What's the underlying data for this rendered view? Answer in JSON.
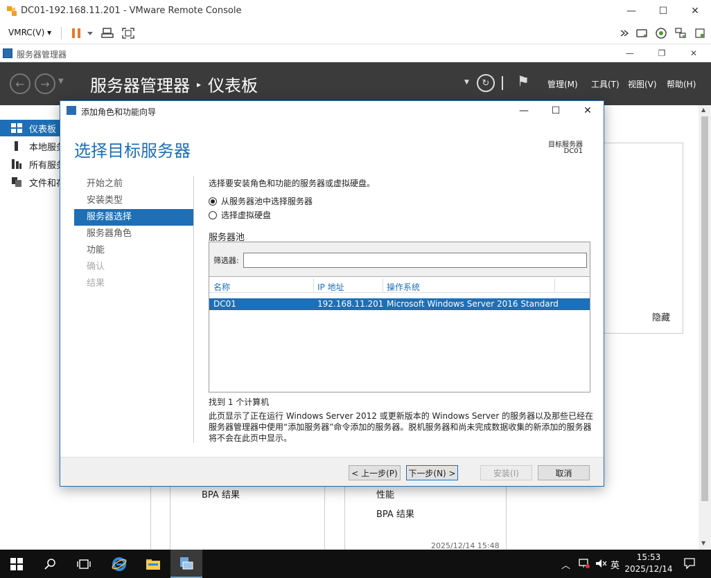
{
  "vmrc": {
    "title": "DC01-192.168.11.201 - VMware Remote Console",
    "menu_label": "VMRC(V)",
    "menu_arrow": "▾",
    "min": "—",
    "max": "☐",
    "close": "✕",
    "icons": [
      "pause-icon",
      "dropdown-icon",
      "send-keys-icon",
      "fullscreen-icon",
      "forward-icon",
      "removable-devices-icon",
      "vm-state-icon",
      "network-icon"
    ]
  },
  "server_manager": {
    "title": "服务器管理器",
    "breadcrumb_root": "服务器管理器",
    "breadcrumb_sep": "▸",
    "breadcrumb_page": "仪表板",
    "menus": [
      "管理(M)",
      "工具(T)",
      "视图(V)",
      "帮助(H)"
    ],
    "sidebar": [
      {
        "label": "仪表板",
        "active": true
      },
      {
        "label": "本地服务器",
        "active": false
      },
      {
        "label": "所有服务器",
        "active": false
      },
      {
        "label": "文件和存储服务",
        "active": false
      }
    ],
    "hide_label": "隐藏",
    "tiles": {
      "left_text": "BPA 结果",
      "right_perf": "性能",
      "right_bpa": "BPA 结果",
      "timestamp": "2025/12/14 15:48"
    }
  },
  "wizard": {
    "title": "添加角色和功能向导",
    "heading": "选择目标服务器",
    "target_label": "目标服务器",
    "target_value": "DC01",
    "steps": [
      {
        "label": "开始之前",
        "state": "normal"
      },
      {
        "label": "安装类型",
        "state": "normal"
      },
      {
        "label": "服务器选择",
        "state": "active"
      },
      {
        "label": "服务器角色",
        "state": "normal"
      },
      {
        "label": "功能",
        "state": "normal"
      },
      {
        "label": "确认",
        "state": "disabled"
      },
      {
        "label": "结果",
        "state": "disabled"
      }
    ],
    "intro": "选择要安装角色和功能的服务器或虚拟硬盘。",
    "options": [
      {
        "label": "从服务器池中选择服务器",
        "checked": true
      },
      {
        "label": "选择虚拟硬盘",
        "checked": false
      }
    ],
    "pool_label": "服务器池",
    "filter_label": "筛选器:",
    "filter_value": "",
    "columns": [
      "名称",
      "IP 地址",
      "操作系统"
    ],
    "rows": [
      {
        "name": "DC01",
        "ip": "192.168.11.201",
        "os": "Microsoft Windows Server 2016 Standard",
        "selected": true
      }
    ],
    "found_text": "找到 1 个计算机",
    "note_text": "此页显示了正在运行 Windows Server 2012 或更新版本的 Windows Server 的服务器以及那些已经在服务器管理器中使用“添加服务器”命令添加的服务器。脱机服务器和尚未完成数据收集的新添加的服务器将不会在此页中显示。",
    "buttons": {
      "prev": "< 上一步(P)",
      "next": "下一步(N) >",
      "install": "安装(I)",
      "cancel": "取消"
    }
  },
  "taskbar": {
    "time": "15:53",
    "date": "2025/12/14",
    "ime": "英",
    "icons": [
      "start-icon",
      "search-icon",
      "task-view-icon",
      "edge-icon",
      "file-explorer-icon",
      "server-manager-icon"
    ]
  }
}
